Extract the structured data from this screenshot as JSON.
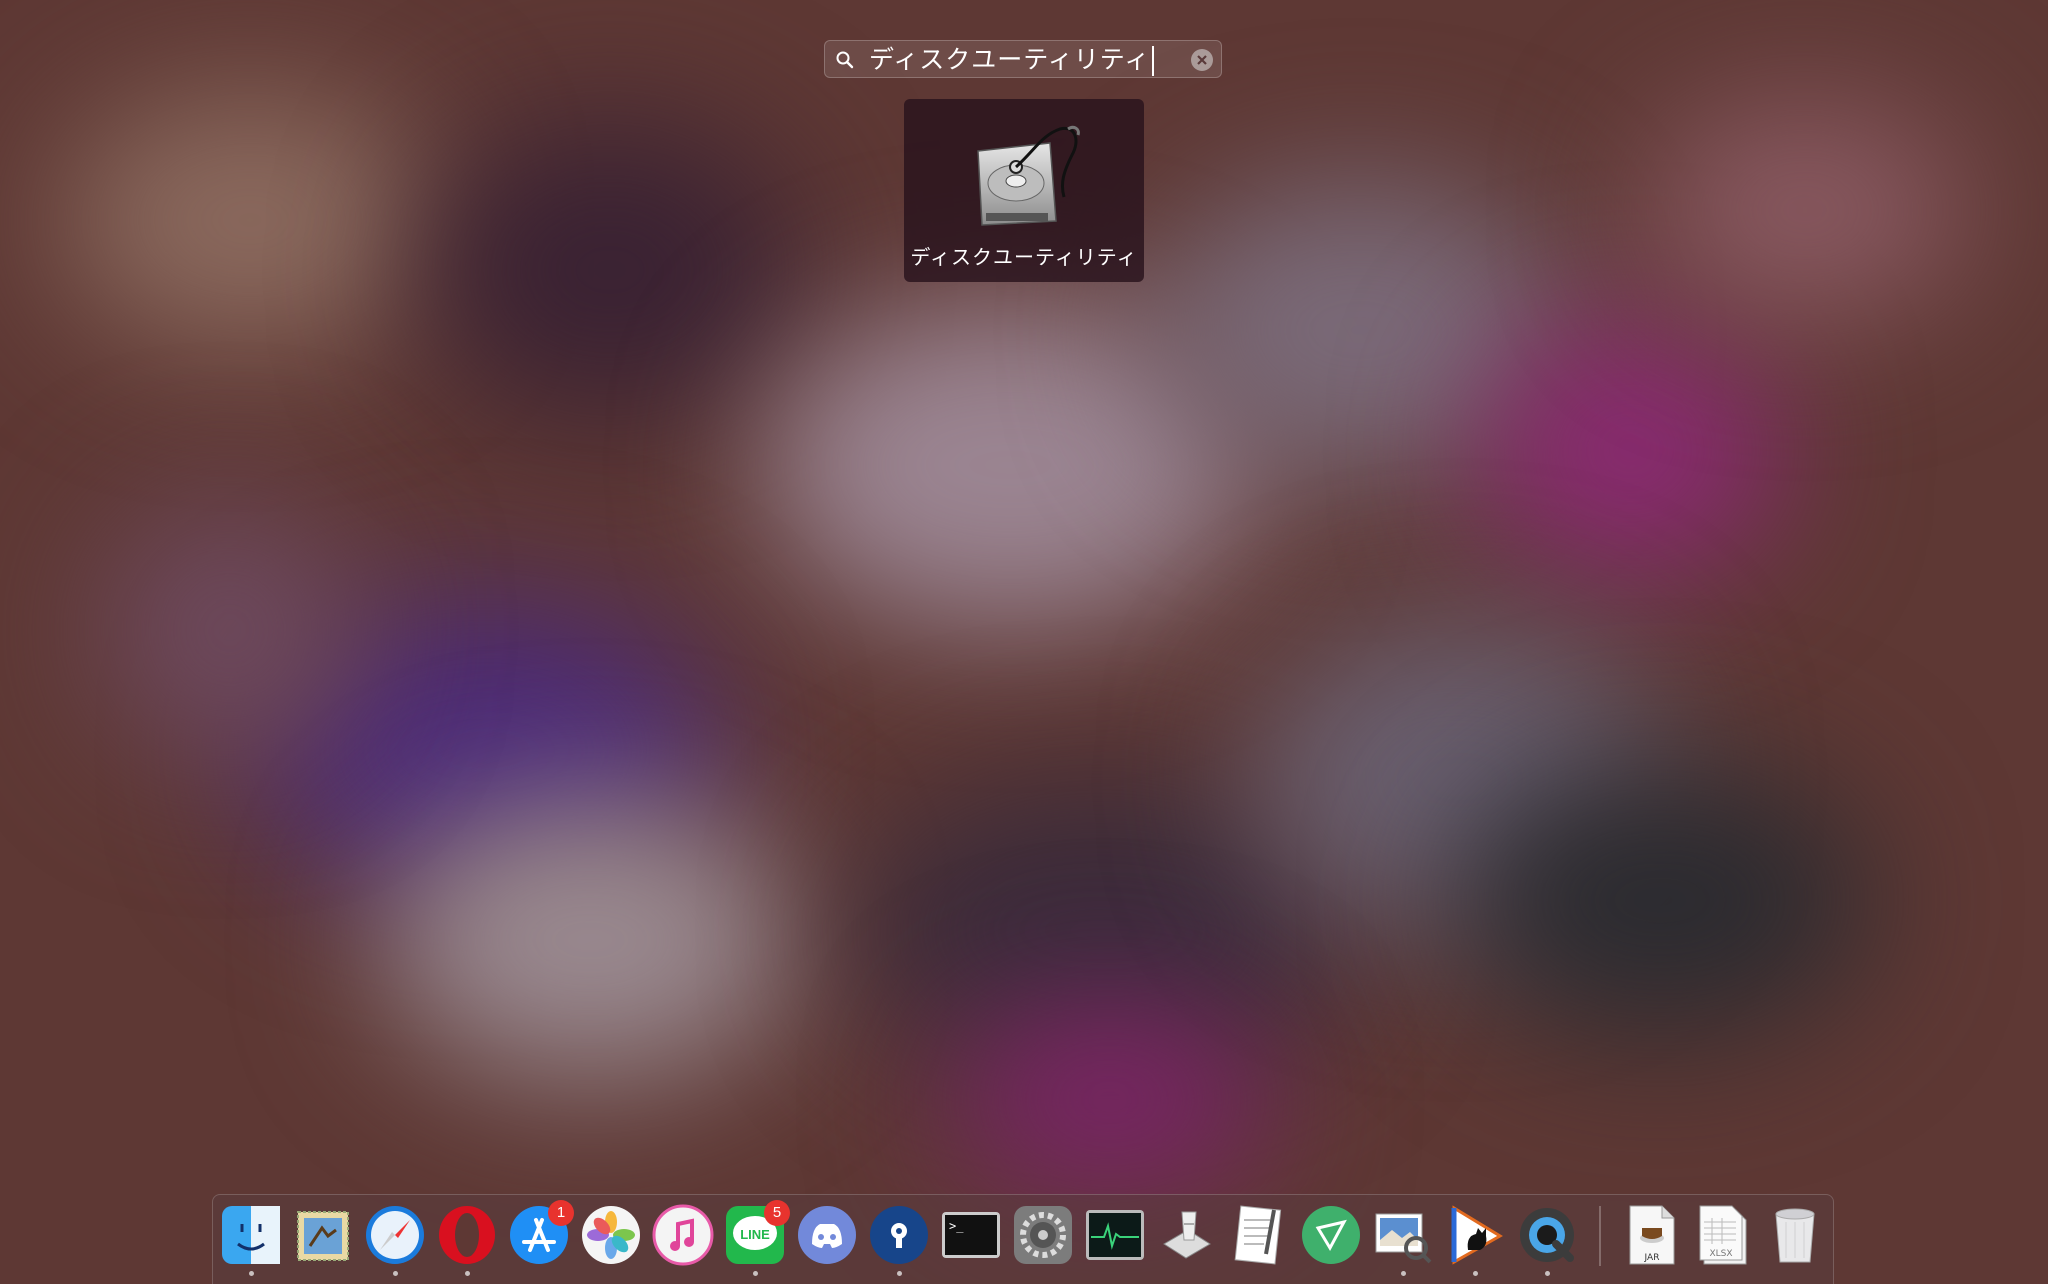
{
  "launchpad": {
    "search": {
      "query": "ディスクユーティリティ",
      "icon": "search-icon",
      "clear_icon": "clear-icon"
    },
    "results": [
      {
        "label": "ディスクユーティリティ",
        "icon": "disk-utility-icon"
      }
    ]
  },
  "dock": {
    "apps": [
      {
        "name": "finder",
        "icon": "finder-icon",
        "running": true
      },
      {
        "name": "mail",
        "icon": "mail-icon",
        "running": false
      },
      {
        "name": "safari",
        "icon": "safari-icon",
        "running": true
      },
      {
        "name": "opera",
        "icon": "opera-icon",
        "running": true
      },
      {
        "name": "app-store",
        "icon": "app-store-icon",
        "running": false,
        "badge": "1"
      },
      {
        "name": "photos",
        "icon": "photos-icon",
        "running": false
      },
      {
        "name": "itunes",
        "icon": "itunes-icon",
        "running": false
      },
      {
        "name": "line",
        "icon": "line-icon",
        "running": true,
        "badge": "5"
      },
      {
        "name": "discord",
        "icon": "discord-icon",
        "running": false
      },
      {
        "name": "bitwarden",
        "icon": "bitwarden-icon",
        "running": true
      },
      {
        "name": "terminal",
        "icon": "terminal-icon",
        "running": false
      },
      {
        "name": "system-preferences",
        "icon": "gear-icon",
        "running": false
      },
      {
        "name": "activity-monitor",
        "icon": "activity-monitor-icon",
        "running": false
      },
      {
        "name": "script-editor",
        "icon": "script-editor-icon",
        "running": false
      },
      {
        "name": "textedit",
        "icon": "textedit-icon",
        "running": false
      },
      {
        "name": "green-triangle-app",
        "icon": "triangle-icon",
        "running": false
      },
      {
        "name": "preview",
        "icon": "preview-icon",
        "running": true
      },
      {
        "name": "cat-app",
        "icon": "cat-icon",
        "running": true
      },
      {
        "name": "quicktime",
        "icon": "quicktime-icon",
        "running": true
      }
    ],
    "files": [
      {
        "name": "jar-file",
        "icon": "jar-file-icon",
        "label": "JAR"
      },
      {
        "name": "xlsx-file",
        "icon": "xlsx-file-icon",
        "label": "XLSX"
      },
      {
        "name": "trash",
        "icon": "trash-icon"
      }
    ]
  }
}
